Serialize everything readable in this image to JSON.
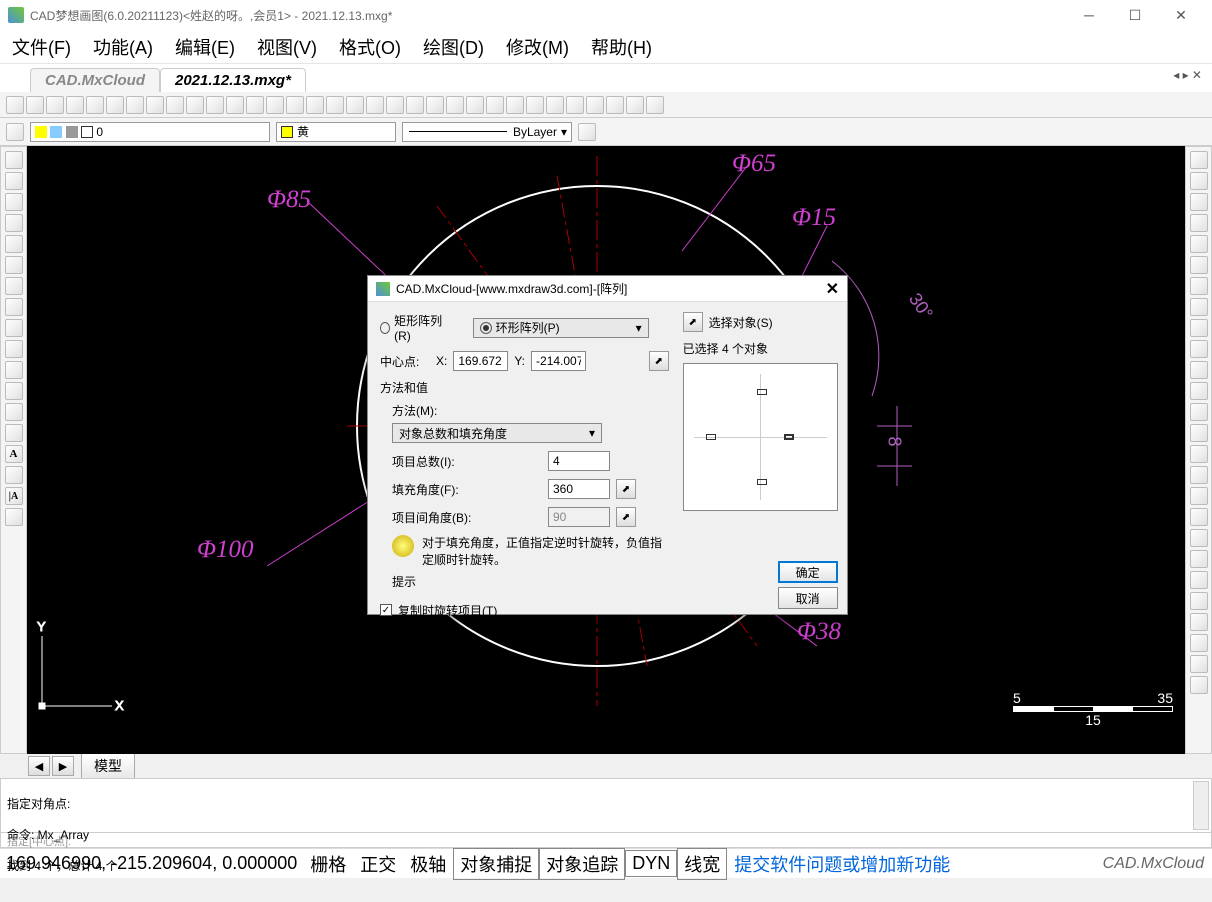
{
  "title": "CAD梦想画图(6.0.20211123)<姓赵的呀。,会员1> - 2021.12.13.mxg*",
  "menus": [
    "文件(F)",
    "功能(A)",
    "编辑(E)",
    "视图(V)",
    "格式(O)",
    "绘图(D)",
    "修改(M)",
    "帮助(H)"
  ],
  "tabs": {
    "inactive": "CAD.MxCloud",
    "active": "2021.12.13.mxg*"
  },
  "layer": {
    "value": "0",
    "color": "黄",
    "linetype": "ByLayer"
  },
  "canvas": {
    "dims": {
      "d65": "Φ65",
      "d85": "Φ85",
      "d15": "Φ15",
      "d100": "Φ100",
      "d38": "Φ38"
    },
    "angle": "30°",
    "linear": "8",
    "ruler": {
      "left": "5",
      "right": "35",
      "sub": "15"
    },
    "axes": {
      "x": "X",
      "y": "Y"
    }
  },
  "model_tab": "模型",
  "cmd": {
    "l1": "指定对角点:",
    "l2": "命令: Mx_Array",
    "l3": "找到 4 个，总计 4 个",
    "prompt": "指定[中心点]:"
  },
  "status": {
    "coords": "169.946990,  -215.209604,  0.000000",
    "btns": [
      "栅格",
      "正交",
      "极轴",
      "对象捕捉",
      "对象追踪",
      "DYN",
      "线宽"
    ],
    "link": "提交软件问题或增加新功能",
    "brand": "CAD.MxCloud"
  },
  "dialog": {
    "title": "CAD.MxCloud-[www.mxdraw3d.com]-[阵列]",
    "rect_radio": "矩形阵列(R)",
    "polar_radio": "环形阵列(P)",
    "center_lbl": "中心点:",
    "x_lbl": "X:",
    "x_val": "169.672",
    "y_lbl": "Y:",
    "y_val": "-214.007",
    "sect": "方法和值",
    "method_lbl": "方法(M):",
    "method_val": "对象总数和填充角度",
    "count_lbl": "项目总数(I):",
    "count_val": "4",
    "fill_lbl": "填充角度(F):",
    "fill_val": "360",
    "between_lbl": "项目间角度(B):",
    "between_val": "90",
    "hint_text": "对于填充角度，正值指定逆时针旋转，负值指定顺时针旋转。",
    "hint_lbl": "提示",
    "rotate_cb": "复制时旋转项目(T)",
    "select_btn": "选择对象(S)",
    "selected": "已选择 4 个对象",
    "ok": "确定",
    "cancel": "取消"
  }
}
